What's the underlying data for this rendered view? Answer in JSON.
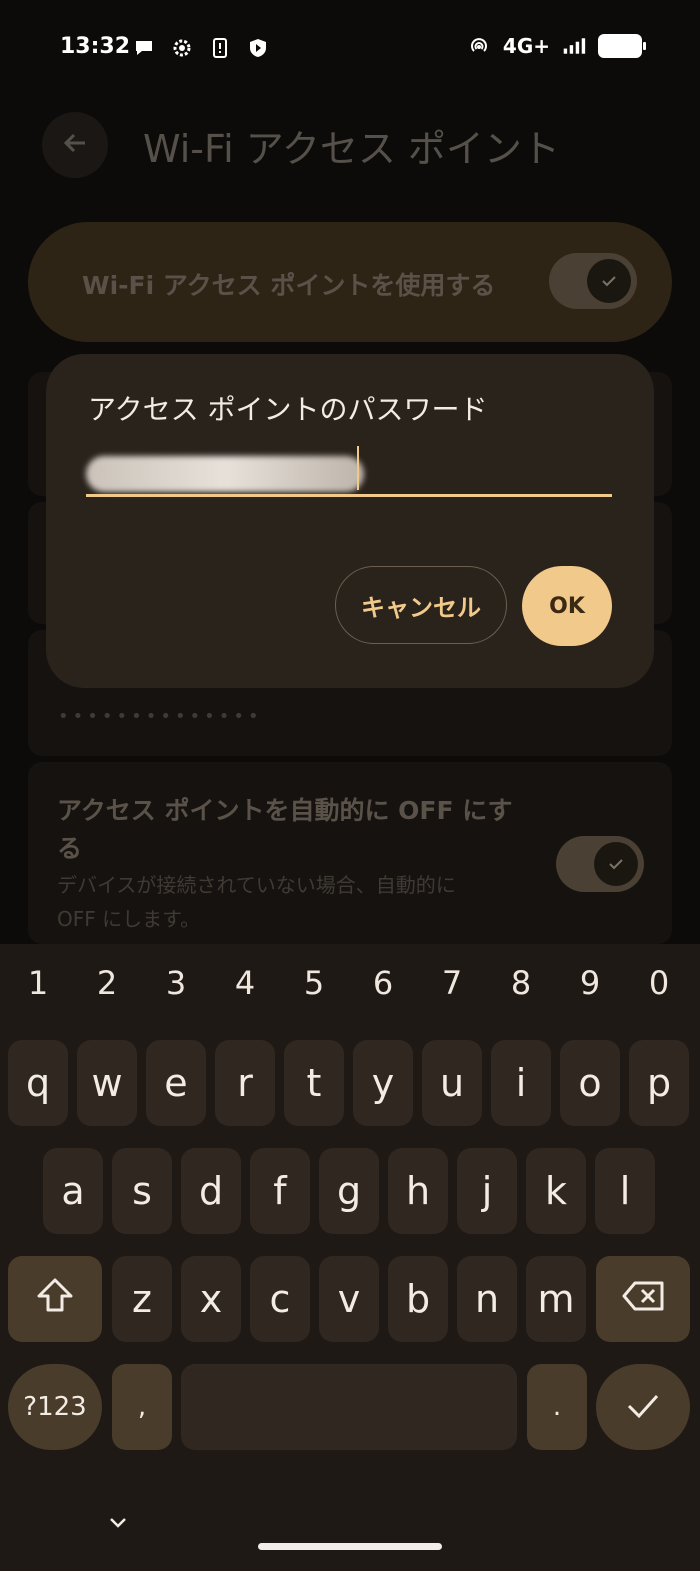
{
  "status_bar": {
    "time": "13:32",
    "left_icons": [
      "chat-bubble-icon",
      "gear-icon",
      "phone-alert-icon",
      "shield-play-icon"
    ],
    "network": "4G+",
    "right_icons": [
      "hotspot-icon",
      "signal-icon",
      "battery-icon"
    ]
  },
  "background": {
    "title": "Wi-Fi アクセス ポイント",
    "master_toggle_label": "Wi-Fi アクセス ポイントを使用する",
    "password_dots": "••••••••••••••",
    "auto_off_title": "アクセス ポイントを自動的に OFF にする",
    "auto_off_desc": "デバイスが接続されていない場合、自動的に OFF にします。"
  },
  "dialog": {
    "title": "アクセス ポイントのパスワード",
    "cancel_label": "キャンセル",
    "ok_label": "OK"
  },
  "keyboard": {
    "numbers": [
      "1",
      "2",
      "3",
      "4",
      "5",
      "6",
      "7",
      "8",
      "9",
      "0"
    ],
    "row1": [
      "q",
      "w",
      "e",
      "r",
      "t",
      "y",
      "u",
      "i",
      "o",
      "p"
    ],
    "row2": [
      "a",
      "s",
      "d",
      "f",
      "g",
      "h",
      "j",
      "k",
      "l"
    ],
    "row3": [
      "z",
      "x",
      "c",
      "v",
      "b",
      "n",
      "m"
    ],
    "symbols_label": "?123",
    "comma": ",",
    "period": "."
  },
  "colors": {
    "accent": "#f1c98b",
    "dialog_bg": "#2a231c",
    "keyboard_bg": "#1f1915"
  }
}
